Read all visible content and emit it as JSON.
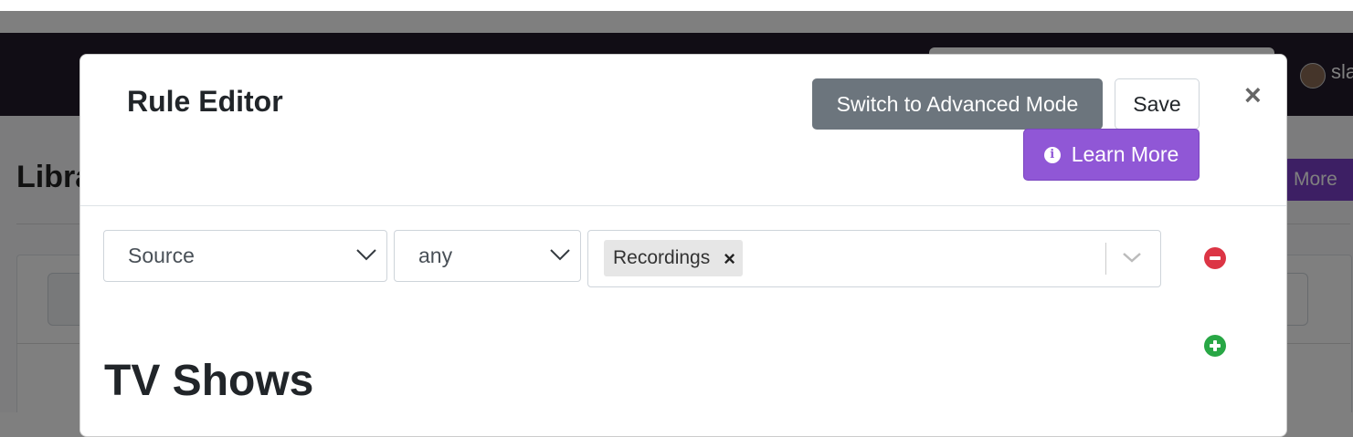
{
  "background": {
    "user_name": "sla",
    "heading": "Libra",
    "more_button": "More"
  },
  "modal": {
    "title": "Rule Editor",
    "advanced_button": "Switch to Advanced Mode",
    "save_button": "Save",
    "learn_more_button": "Learn More",
    "close_symbol": "×"
  },
  "rule": {
    "field_select": "Source",
    "operator_select": "any",
    "values": [
      {
        "label": "Recordings",
        "remove_symbol": "×"
      }
    ]
  },
  "section": {
    "heading": "TV Shows"
  },
  "colors": {
    "primary_purple": "#9057d6",
    "secondary_gray": "#6c757d",
    "danger_red": "#dc3545",
    "success_green": "#28a745",
    "navbar_dark": "#231a2b"
  },
  "icons": {
    "learn_more": "info-circle-icon",
    "remove_rule": "minus-circle-icon",
    "add_rule": "plus-circle-icon",
    "close": "close-icon",
    "dropdown": "chevron-down-icon"
  }
}
